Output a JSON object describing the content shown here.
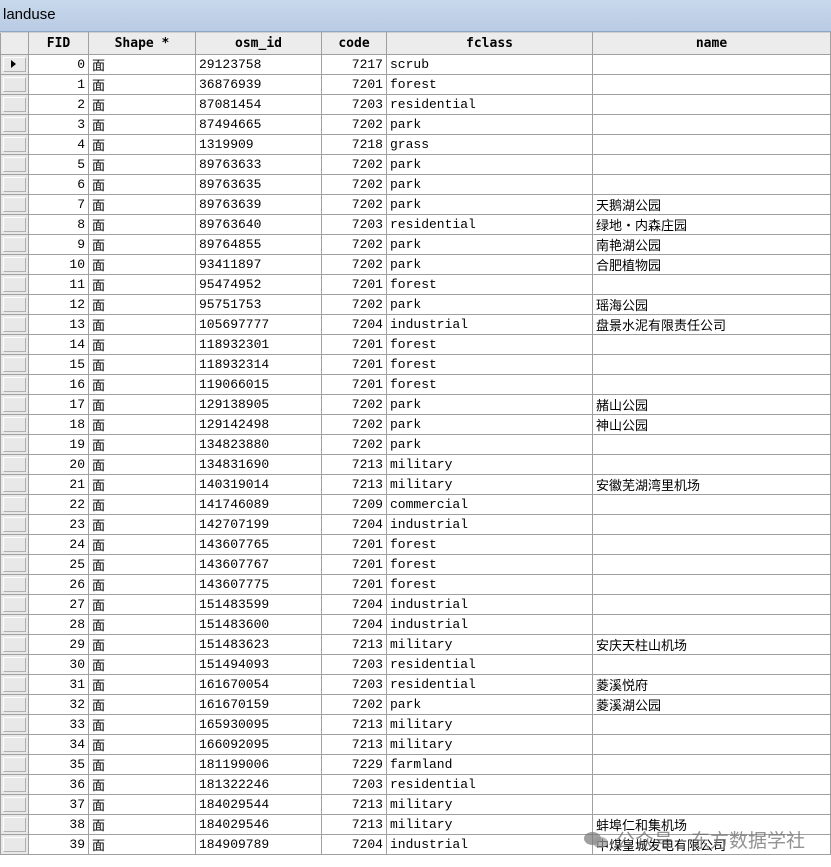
{
  "window": {
    "title": "landuse"
  },
  "columns": [
    "FID",
    "Shape *",
    "osm_id",
    "code",
    "fclass",
    "name"
  ],
  "rows": [
    {
      "fid": "0",
      "shape": "面",
      "osm_id": "29123758",
      "code": "7217",
      "fclass": "scrub",
      "name": ""
    },
    {
      "fid": "1",
      "shape": "面",
      "osm_id": "36876939",
      "code": "7201",
      "fclass": "forest",
      "name": ""
    },
    {
      "fid": "2",
      "shape": "面",
      "osm_id": "87081454",
      "code": "7203",
      "fclass": "residential",
      "name": ""
    },
    {
      "fid": "3",
      "shape": "面",
      "osm_id": "87494665",
      "code": "7202",
      "fclass": "park",
      "name": ""
    },
    {
      "fid": "4",
      "shape": "面",
      "osm_id": "1319909",
      "code": "7218",
      "fclass": "grass",
      "name": ""
    },
    {
      "fid": "5",
      "shape": "面",
      "osm_id": "89763633",
      "code": "7202",
      "fclass": "park",
      "name": ""
    },
    {
      "fid": "6",
      "shape": "面",
      "osm_id": "89763635",
      "code": "7202",
      "fclass": "park",
      "name": ""
    },
    {
      "fid": "7",
      "shape": "面",
      "osm_id": "89763639",
      "code": "7202",
      "fclass": "park",
      "name": "天鹅湖公园"
    },
    {
      "fid": "8",
      "shape": "面",
      "osm_id": "89763640",
      "code": "7203",
      "fclass": "residential",
      "name": "绿地・内森庄园"
    },
    {
      "fid": "9",
      "shape": "面",
      "osm_id": "89764855",
      "code": "7202",
      "fclass": "park",
      "name": "南艳湖公园"
    },
    {
      "fid": "10",
      "shape": "面",
      "osm_id": "93411897",
      "code": "7202",
      "fclass": "park",
      "name": "合肥植物园"
    },
    {
      "fid": "11",
      "shape": "面",
      "osm_id": "95474952",
      "code": "7201",
      "fclass": "forest",
      "name": ""
    },
    {
      "fid": "12",
      "shape": "面",
      "osm_id": "95751753",
      "code": "7202",
      "fclass": "park",
      "name": "瑶海公园"
    },
    {
      "fid": "13",
      "shape": "面",
      "osm_id": "105697777",
      "code": "7204",
      "fclass": "industrial",
      "name": "盘景水泥有限责任公司"
    },
    {
      "fid": "14",
      "shape": "面",
      "osm_id": "118932301",
      "code": "7201",
      "fclass": "forest",
      "name": ""
    },
    {
      "fid": "15",
      "shape": "面",
      "osm_id": "118932314",
      "code": "7201",
      "fclass": "forest",
      "name": ""
    },
    {
      "fid": "16",
      "shape": "面",
      "osm_id": "119066015",
      "code": "7201",
      "fclass": "forest",
      "name": ""
    },
    {
      "fid": "17",
      "shape": "面",
      "osm_id": "129138905",
      "code": "7202",
      "fclass": "park",
      "name": "赭山公园"
    },
    {
      "fid": "18",
      "shape": "面",
      "osm_id": "129142498",
      "code": "7202",
      "fclass": "park",
      "name": "神山公园"
    },
    {
      "fid": "19",
      "shape": "面",
      "osm_id": "134823880",
      "code": "7202",
      "fclass": "park",
      "name": ""
    },
    {
      "fid": "20",
      "shape": "面",
      "osm_id": "134831690",
      "code": "7213",
      "fclass": "military",
      "name": ""
    },
    {
      "fid": "21",
      "shape": "面",
      "osm_id": "140319014",
      "code": "7213",
      "fclass": "military",
      "name": "安徽芜湖湾里机场"
    },
    {
      "fid": "22",
      "shape": "面",
      "osm_id": "141746089",
      "code": "7209",
      "fclass": "commercial",
      "name": ""
    },
    {
      "fid": "23",
      "shape": "面",
      "osm_id": "142707199",
      "code": "7204",
      "fclass": "industrial",
      "name": ""
    },
    {
      "fid": "24",
      "shape": "面",
      "osm_id": "143607765",
      "code": "7201",
      "fclass": "forest",
      "name": ""
    },
    {
      "fid": "25",
      "shape": "面",
      "osm_id": "143607767",
      "code": "7201",
      "fclass": "forest",
      "name": ""
    },
    {
      "fid": "26",
      "shape": "面",
      "osm_id": "143607775",
      "code": "7201",
      "fclass": "forest",
      "name": ""
    },
    {
      "fid": "27",
      "shape": "面",
      "osm_id": "151483599",
      "code": "7204",
      "fclass": "industrial",
      "name": ""
    },
    {
      "fid": "28",
      "shape": "面",
      "osm_id": "151483600",
      "code": "7204",
      "fclass": "industrial",
      "name": ""
    },
    {
      "fid": "29",
      "shape": "面",
      "osm_id": "151483623",
      "code": "7213",
      "fclass": "military",
      "name": "安庆天柱山机场"
    },
    {
      "fid": "30",
      "shape": "面",
      "osm_id": "151494093",
      "code": "7203",
      "fclass": "residential",
      "name": ""
    },
    {
      "fid": "31",
      "shape": "面",
      "osm_id": "161670054",
      "code": "7203",
      "fclass": "residential",
      "name": "菱溪悦府"
    },
    {
      "fid": "32",
      "shape": "面",
      "osm_id": "161670159",
      "code": "7202",
      "fclass": "park",
      "name": "菱溪湖公园"
    },
    {
      "fid": "33",
      "shape": "面",
      "osm_id": "165930095",
      "code": "7213",
      "fclass": "military",
      "name": ""
    },
    {
      "fid": "34",
      "shape": "面",
      "osm_id": "166092095",
      "code": "7213",
      "fclass": "military",
      "name": ""
    },
    {
      "fid": "35",
      "shape": "面",
      "osm_id": "181199006",
      "code": "7229",
      "fclass": "farmland",
      "name": ""
    },
    {
      "fid": "36",
      "shape": "面",
      "osm_id": "181322246",
      "code": "7203",
      "fclass": "residential",
      "name": ""
    },
    {
      "fid": "37",
      "shape": "面",
      "osm_id": "184029544",
      "code": "7213",
      "fclass": "military",
      "name": ""
    },
    {
      "fid": "38",
      "shape": "面",
      "osm_id": "184029546",
      "code": "7213",
      "fclass": "military",
      "name": "蚌埠仁和集机场"
    },
    {
      "fid": "39",
      "shape": "面",
      "osm_id": "184909789",
      "code": "7204",
      "fclass": "industrial",
      "name": "中煤皇城发电有限公司"
    }
  ],
  "watermark": "公众号 · 东方数据学社"
}
